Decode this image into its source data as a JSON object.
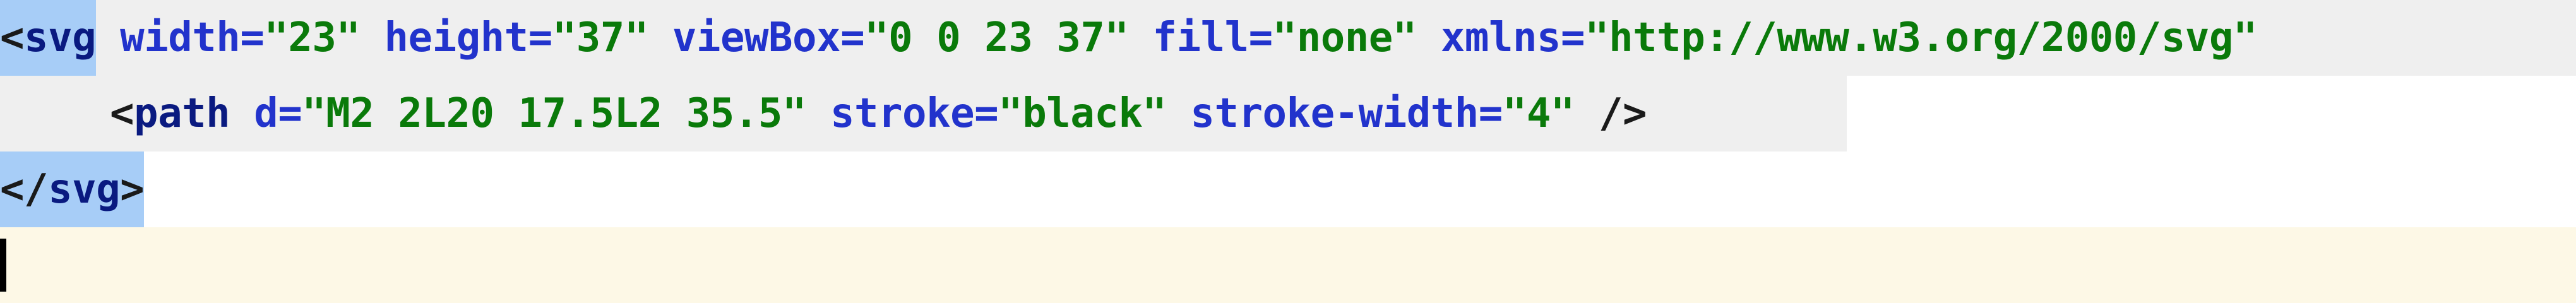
{
  "editor": {
    "line1": {
      "open": "<",
      "tag": "svg",
      "attrs": [
        {
          "name": "width",
          "eq": "=",
          "value": "\"23\""
        },
        {
          "name": "height",
          "eq": "=",
          "value": "\"37\""
        },
        {
          "name": "viewBox",
          "eq": "=",
          "value": "\"0 0 23 37\""
        },
        {
          "name": "fill",
          "eq": "=",
          "value": "\"none\""
        },
        {
          "name": "xmlns",
          "eq": "=",
          "value": "\"http://www.w3.org/2000/svg\""
        }
      ]
    },
    "line2": {
      "open": "<",
      "tag": "path",
      "attrs": [
        {
          "name": "d",
          "eq": "=",
          "value": "\"M2 2L20 17.5L2 35.5\""
        },
        {
          "name": "stroke",
          "eq": "=",
          "value": "\"black\""
        },
        {
          "name": "stroke-width",
          "eq": "=",
          "value": "\"4\""
        }
      ],
      "close": "/>"
    },
    "line3": {
      "open": "</",
      "tag": "svg",
      "close": ">"
    }
  },
  "colors": {
    "tag": "#0a1a80",
    "attribute": "#2233cc",
    "string": "#0a7a0a",
    "tag_match_highlight": "#a7cdf7",
    "line_background": "#efefef",
    "current_line_background": "#fdf8e6"
  }
}
